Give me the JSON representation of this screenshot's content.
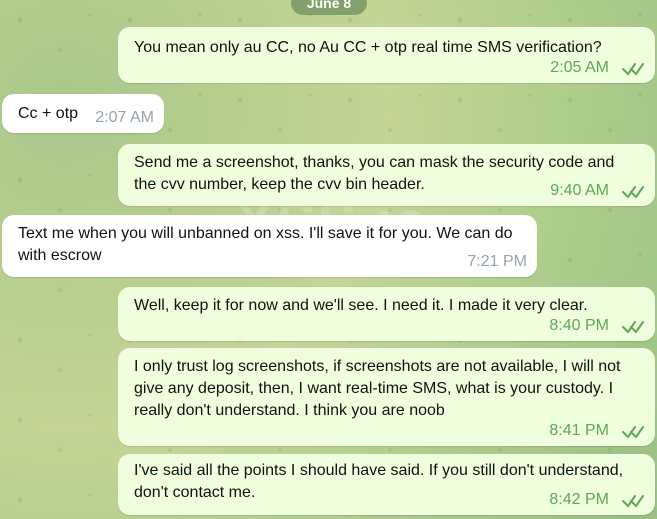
{
  "chat": {
    "date_label": "June 8",
    "watermark_text": "XSS.is",
    "accent_outgoing_bubble": "#efffde",
    "accent_incoming_bubble": "#ffffff",
    "accent_time_outgoing": "#5fa65b",
    "accent_time_incoming": "#97a2ad",
    "messages": [
      {
        "direction": "outgoing",
        "text": "You mean only au CC, no Au CC + otp real time SMS verification?",
        "time": "2:05 AM",
        "status_icon": "double-check-read-icon"
      },
      {
        "direction": "incoming",
        "text": "Cc + otp",
        "time": "2:07 AM"
      },
      {
        "direction": "outgoing",
        "text": "Send me a screenshot, thanks, you can mask the security code and the cvv number, keep the cvv bin header.",
        "time": "9:40 AM",
        "status_icon": "double-check-read-icon"
      },
      {
        "direction": "incoming",
        "text": "Text me when you will unbanned on xss. I'll save it for you. We can do with escrow",
        "time": "7:21 PM"
      },
      {
        "direction": "outgoing",
        "text": "Well, keep it for now and we'll see. I need it. I made it very clear.",
        "time": "8:40 PM",
        "status_icon": "double-check-read-icon"
      },
      {
        "direction": "outgoing",
        "text": "I only trust log screenshots, if screenshots are not available, I will not give any deposit, then, I want real-time SMS, what is your custody. I really don't understand. I think you are noob",
        "time": "8:41 PM",
        "status_icon": "double-check-read-icon"
      },
      {
        "direction": "outgoing",
        "text": "I've said all the points I should have said. If you still don't understand, don't contact me.",
        "time": "8:42 PM",
        "status_icon": "double-check-read-icon"
      }
    ]
  }
}
